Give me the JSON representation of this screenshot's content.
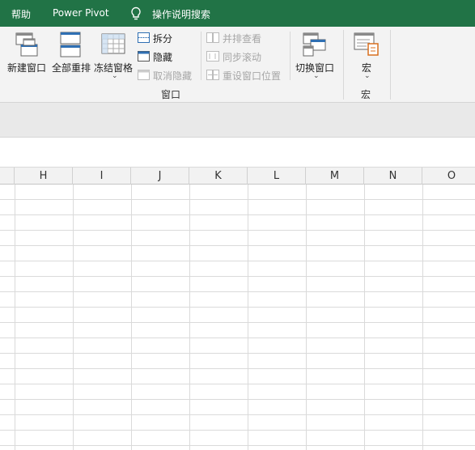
{
  "tabs": {
    "help": "帮助",
    "power_pivot": "Power Pivot",
    "tell_me": "操作说明搜索"
  },
  "ribbon": {
    "window_group": {
      "new_window": "新建窗口",
      "arrange_all": "全部重排",
      "freeze_panes": "冻结窗格",
      "split": "拆分",
      "hide": "隐藏",
      "unhide": "取消隐藏",
      "view_side_by_side": "并排查看",
      "synchronous_scrolling": "同步滚动",
      "reset_window_position": "重设窗口位置",
      "switch_windows": "切换窗口",
      "label": "窗口"
    },
    "macros_group": {
      "macros": "宏",
      "label": "宏"
    }
  },
  "columns": [
    "H",
    "I",
    "J",
    "K",
    "L",
    "M",
    "N",
    "O"
  ],
  "colors": {
    "accent": "#217346",
    "ribbon_bg": "#f3f3f3",
    "disabled_text": "#a6a6a6",
    "gridline": "#d9d9d9",
    "macro_accent": "#d86f1e"
  }
}
